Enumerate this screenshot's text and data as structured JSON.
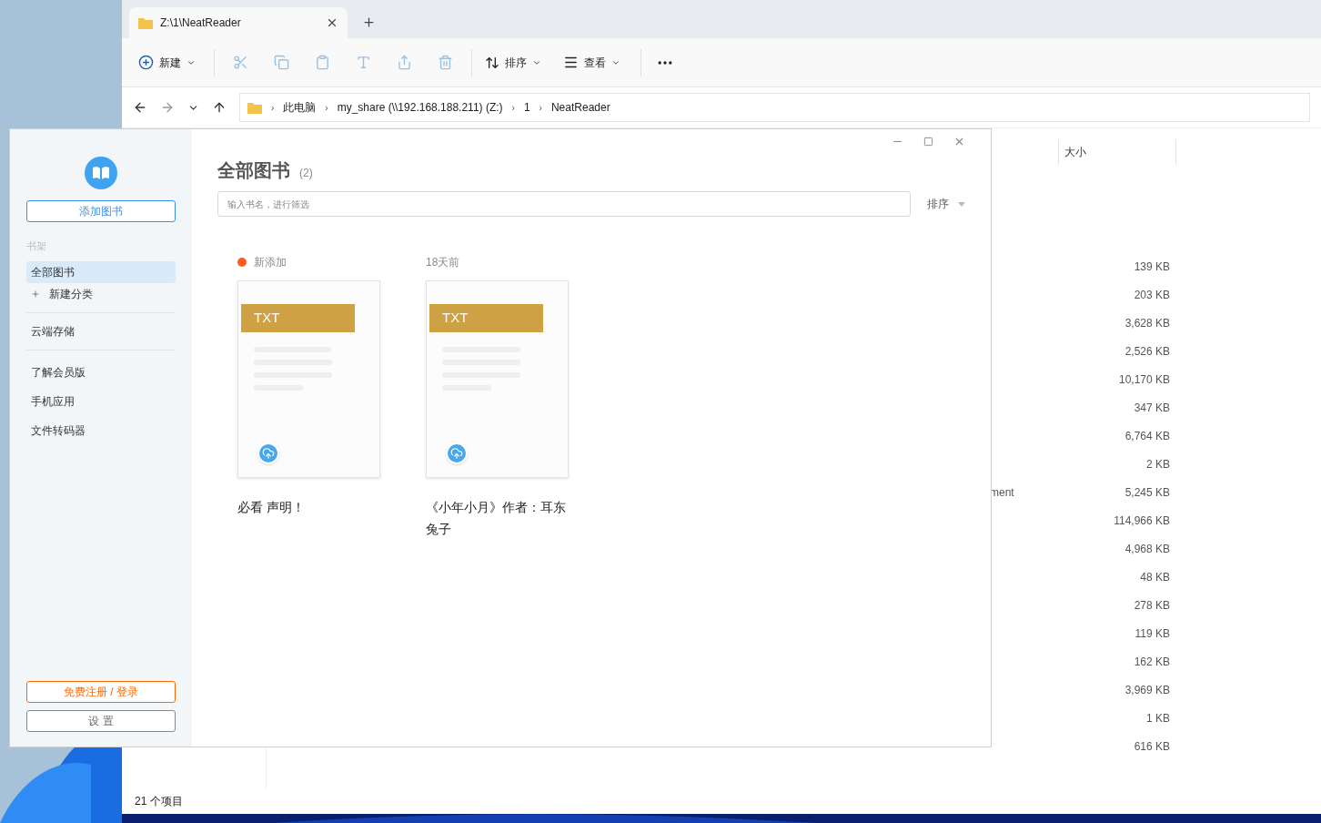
{
  "explorer": {
    "tabs": [
      {
        "label": "Z:\\1\\NeatReader",
        "selected": true
      }
    ],
    "toolbar": {
      "new_label": "新建",
      "sort_label": "排序",
      "view_label": "查看"
    },
    "breadcrumb_separator": "›",
    "breadcrumb": [
      "此电脑",
      "my_share (\\\\192.168.188.211) (Z:)",
      "1",
      "NeatReader"
    ],
    "size_header": "大小",
    "rows": [
      {
        "size": "139 KB"
      },
      {
        "size": "203 KB"
      },
      {
        "size": "3,628 KB"
      },
      {
        "size": "2,526 KB"
      },
      {
        "size": "10,170 KB"
      },
      {
        "size": "347 KB"
      },
      {
        "size": "6,764 KB"
      },
      {
        "size": "2 KB"
      },
      {
        "name": "ment",
        "size": "5,245 KB"
      },
      {
        "size": "114,966 KB"
      },
      {
        "size": "4,968 KB"
      },
      {
        "size": "48 KB"
      },
      {
        "size": "278 KB"
      },
      {
        "size": "119 KB"
      },
      {
        "size": "162 KB"
      },
      {
        "size": "3,969 KB"
      },
      {
        "size": "1 KB"
      },
      {
        "size": "616 KB"
      }
    ],
    "status": "21 个项目"
  },
  "reader": {
    "add_button": "添加图书",
    "section_label": "书架",
    "nav": [
      {
        "label": "全部图书",
        "kind": "item",
        "selected": true
      },
      {
        "label": "新建分类",
        "kind": "add",
        "selected": false
      },
      {
        "label": "云端存储",
        "kind": "item",
        "selected": false,
        "divider_before": true
      },
      {
        "label": "了解会员版",
        "kind": "item",
        "selected": false,
        "divider_before": true
      },
      {
        "label": "手机应用",
        "kind": "item",
        "selected": false
      },
      {
        "label": "文件转码器",
        "kind": "item",
        "selected": false
      }
    ],
    "register_button": "免费注册 / 登录",
    "settings_button": "设 置",
    "title": "全部图书",
    "count": "(2)",
    "search": {
      "placeholder": "输入书名，进行筛选"
    },
    "sort": "排序",
    "books": [
      {
        "tag": "新添加",
        "is_new": true,
        "format": "TXT",
        "title": "必看 声明！"
      },
      {
        "tag": "18天前",
        "is_new": false,
        "format": "TXT",
        "title": "《小年小月》作者：耳东兔子"
      }
    ]
  }
}
